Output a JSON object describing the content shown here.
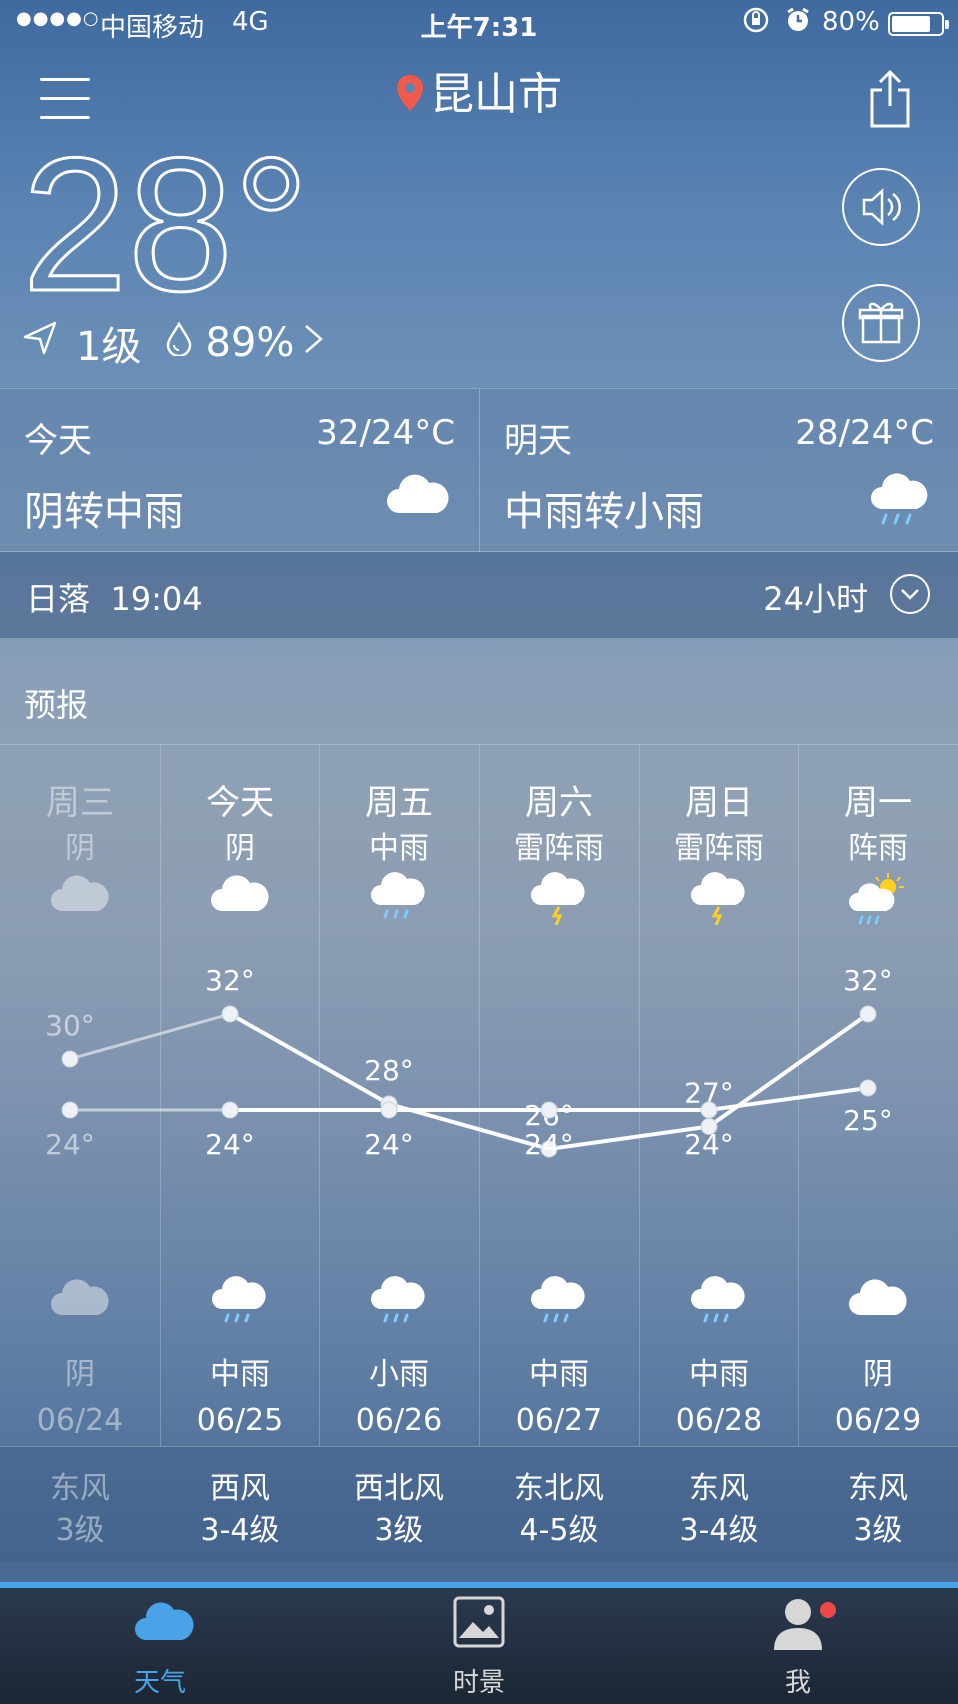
{
  "status_bar": {
    "signal": "●●●●○",
    "carrier": "中国移动",
    "network": "4G",
    "time": "上午7:31",
    "battery": "80%",
    "battery_level": 0.8
  },
  "header": {
    "city": "昆山市",
    "current_temp": "28°",
    "wind_level": "1级",
    "humidity": "89%"
  },
  "today": {
    "label": "今天",
    "range": "32/24°C",
    "desc": "阴转中雨",
    "icon": "cloud-icon"
  },
  "tomorrow": {
    "label": "明天",
    "range": "28/24°C",
    "desc": "中雨转小雨",
    "icon": "rain-cloud-icon"
  },
  "sunset": {
    "label": "日落",
    "time": "19:04",
    "hours_label": "24小时"
  },
  "forecast": {
    "title": "预报",
    "days": [
      {
        "weekday": "周三",
        "day_weather": "阴",
        "day_icon": "cloud",
        "high": "30°",
        "low": "24°",
        "night_icon": "cloud",
        "night_weather": "阴",
        "date": "06/24",
        "wind_dir": "东风",
        "wind_level": "3级",
        "past": true
      },
      {
        "weekday": "今天",
        "day_weather": "阴",
        "day_icon": "cloud",
        "high": "32°",
        "low": "24°",
        "night_icon": "rain",
        "night_weather": "中雨",
        "date": "06/25",
        "wind_dir": "西风",
        "wind_level": "3-4级",
        "past": false
      },
      {
        "weekday": "周五",
        "day_weather": "中雨",
        "day_icon": "rain",
        "high": "28°",
        "low": "24°",
        "night_icon": "rain",
        "night_weather": "小雨",
        "date": "06/26",
        "wind_dir": "西北风",
        "wind_level": "3级",
        "past": false
      },
      {
        "weekday": "周六",
        "day_weather": "雷阵雨",
        "day_icon": "thunder",
        "high": "26°",
        "low": "24°",
        "night_icon": "rain",
        "night_weather": "中雨",
        "date": "06/27",
        "wind_dir": "东北风",
        "wind_level": "4-5级",
        "past": false
      },
      {
        "weekday": "周日",
        "day_weather": "雷阵雨",
        "day_icon": "thunder",
        "high": "27°",
        "low": "24°",
        "night_icon": "rain",
        "night_weather": "中雨",
        "date": "06/28",
        "wind_dir": "东风",
        "wind_level": "3-4级",
        "past": false
      },
      {
        "weekday": "周一",
        "day_weather": "阵雨",
        "day_icon": "sun-rain",
        "high": "32°",
        "low": "25°",
        "night_icon": "cloud",
        "night_weather": "阴",
        "date": "06/29",
        "wind_dir": "东风",
        "wind_level": "3级",
        "past": false
      }
    ]
  },
  "chart_data": {
    "type": "line",
    "categories": [
      "06/24",
      "06/25",
      "06/26",
      "06/27",
      "06/28",
      "06/29"
    ],
    "series": [
      {
        "values": [
          30,
          32,
          28,
          26,
          27,
          32
        ]
      },
      {
        "values": [
          24,
          24,
          24,
          24,
          24,
          25
        ]
      }
    ]
  },
  "tabs": [
    {
      "label": "天气",
      "icon": "cloud-tab-icon",
      "active": true
    },
    {
      "label": "时景",
      "icon": "photo-tab-icon",
      "active": false
    },
    {
      "label": "我",
      "icon": "profile-tab-icon",
      "active": false
    }
  ],
  "colors": {
    "accent": "#4aa3e6",
    "badge": "#f04848",
    "pin": "#f05a4a"
  }
}
